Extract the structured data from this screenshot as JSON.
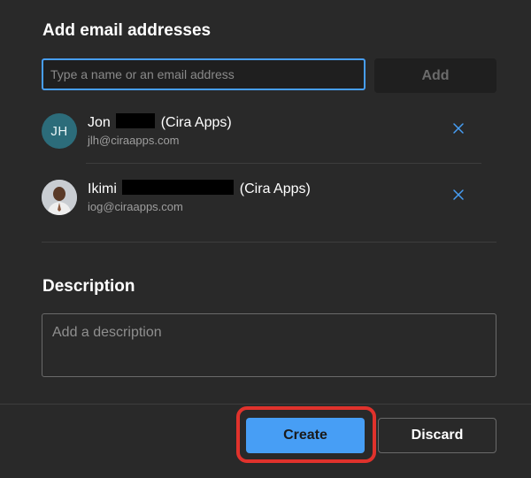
{
  "add_section": {
    "title": "Add email addresses",
    "input_placeholder": "Type a name or an email address",
    "input_value": "",
    "add_label": "Add"
  },
  "people": [
    {
      "initials": "JH",
      "first_name": "Jon",
      "org": "(Cira Apps)",
      "email": "jlh@ciraapps.com",
      "avatar_color": "#2c6c7a"
    },
    {
      "initials": "",
      "first_name": "Ikimi",
      "org": "(Cira Apps)",
      "email": "iog@ciraapps.com",
      "avatar": "photo"
    }
  ],
  "remove_icon": "close-icon",
  "description_section": {
    "title": "Description",
    "placeholder": "Add a description",
    "value": ""
  },
  "footer": {
    "create_label": "Create",
    "discard_label": "Discard"
  },
  "colors": {
    "background": "#292929",
    "accent": "#479ef5",
    "highlight": "#e0322c",
    "input_bg": "#1f1f1f"
  }
}
